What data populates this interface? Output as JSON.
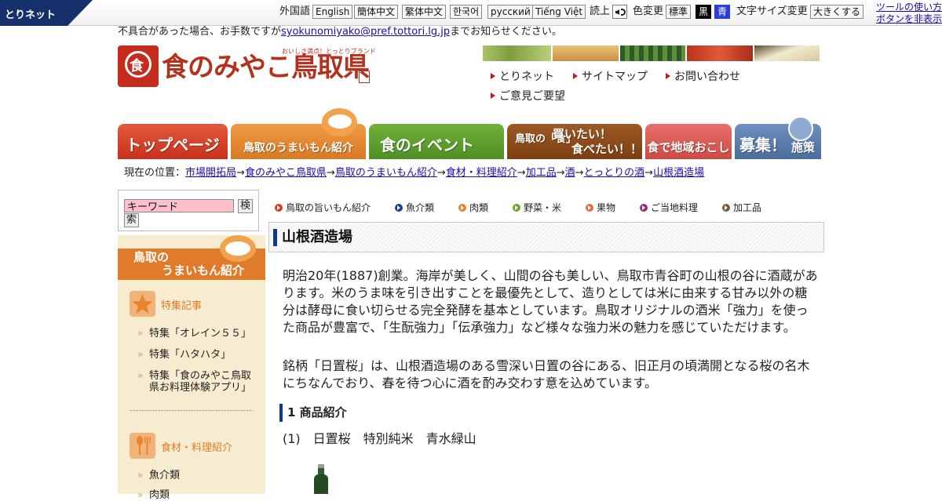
{
  "topbar": {
    "brand": "とりネット",
    "foreign_label": "外国語",
    "languages": [
      "English",
      "簡体中文",
      "繁体中文",
      "한국어",
      "русский",
      "Tiếng Việt"
    ],
    "read_label": "読上",
    "color_label": "色変更",
    "color_options": [
      "標準",
      "黒",
      "青"
    ],
    "fontsize_label": "文字サイズ変更",
    "fontsize_button": "大きくする",
    "hide_tools_line1": "ツールの使い方",
    "hide_tools_line2": "ボタンを非表示"
  },
  "notice": {
    "prefix": "不具合があった場合、お手数ですが",
    "email": "syokunomiyako@pref.tottori.lg.jp",
    "suffix": "までお知らせください。"
  },
  "logo": {
    "text": "食のみやこ鳥取県",
    "tagline": "おいしさ満点！とっとりブランド",
    "seal_char": "食"
  },
  "photos": [
    {
      "name": "photo-pears",
      "color": "#9bb85a"
    },
    {
      "name": "photo-dunes",
      "color": "#d7a45c"
    },
    {
      "name": "photo-watermelon",
      "color": "#3d6b2f"
    },
    {
      "name": "photo-crab",
      "color": "#c8442a"
    },
    {
      "name": "photo-nagaimo",
      "color": "#efe5c4"
    }
  ],
  "util_links": [
    "とりネット",
    "サイトマップ",
    "お問い合わせ",
    "ご意見ご要望"
  ],
  "global_nav": [
    {
      "label": "トップページ",
      "color": "#d43a24"
    },
    {
      "label": "鳥取のうまいもん紹介",
      "color": "#e48a2c"
    },
    {
      "label": "食のイベント",
      "color": "#5a9a2c"
    },
    {
      "label": "鳥取の「食」買いたい！食べたい！！",
      "color": "#8a4a1a",
      "badge": "鳥取の「食」",
      "line1": "買いたい！",
      "line2": "食べたい！！"
    },
    {
      "label": "食で地域おこし",
      "color": "#d9534f"
    },
    {
      "label": "募集！施策",
      "color": "#5a7fb0",
      "big": "募集！",
      "small": "施策"
    }
  ],
  "breadcrumb": {
    "prefix": "現在の位置：",
    "items": [
      "市場開拓局",
      "食のみやこ鳥取県",
      "鳥取のうまいもん紹介",
      "食材・料理紹介",
      "加工品",
      "酒",
      "とっとりの酒",
      "山根酒造場"
    ]
  },
  "search": {
    "value": "キーワード",
    "button_part1": "検",
    "button_part2": "索"
  },
  "sidebar": {
    "title_line1": "鳥取の",
    "title_line2": "うまいもん紹介",
    "sections": [
      {
        "label": "特集記事",
        "items": [
          "特集「オレイン５５」",
          "特集「ハタハタ」",
          "特集「食のみやこ鳥取県お料理体験アプリ」"
        ]
      },
      {
        "label": "食材・料理紹介",
        "items": [
          "魚介類",
          "肉類"
        ]
      }
    ]
  },
  "category_tabs": [
    {
      "label": "鳥取の旨いもん紹介",
      "color": "#d43a24"
    },
    {
      "label": "魚介類",
      "color": "#1d3f8a"
    },
    {
      "label": "肉類",
      "color": "#e8842a"
    },
    {
      "label": "野菜・米",
      "color": "#6aa52e"
    },
    {
      "label": "果物",
      "color": "#e36a44"
    },
    {
      "label": "ご当地料理",
      "color": "#9a2a7a"
    },
    {
      "label": "加工品",
      "color": "#7a5a3a"
    }
  ],
  "article": {
    "title": "山根酒造場",
    "paragraph1": "明治20年(1887)創業。海岸が美しく、山間の谷も美しい、鳥取市青谷町の山根の谷に酒蔵があります。米のうま味を引き出すことを最優先として、造りとしては米に由来する甘み以外の糖分は酵母に食い切らせる完全発酵を基本としています。鳥取オリジナルの酒米「強力」を使った商品が豊富で、「生酛強力」「伝承強力」など様々な強力米の魅力を感じていただけます。",
    "paragraph2": "銘柄「日置桜」は、山根酒造場のある雪深い日置の谷にある、旧正月の頃満開となる桜の名木にちなんでおり、春を待つ心に酒を酌み交わす意を込めています。",
    "section_heading": "1  商品紹介",
    "product_title": "(1)　日置桜　特別純米　青水緑山"
  }
}
